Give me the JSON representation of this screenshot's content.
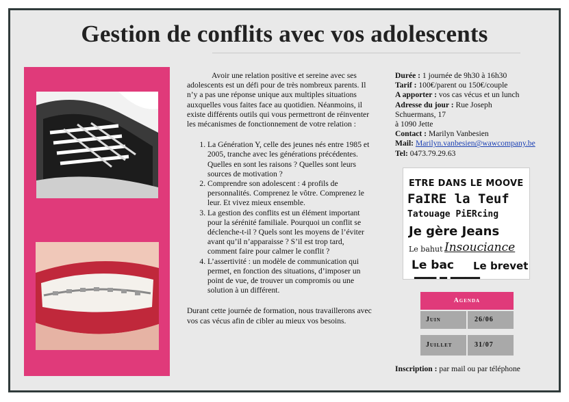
{
  "title": "Gestion de conflits avec vos adolescents",
  "intro": "Avoir une relation positive et sereine avec ses adolescents est un défi pour de très nombreux parents. Il n’y a pas une réponse unique aux multiples situations auxquelles vous faites face au quotidien. Néanmoins, il existe différents outils qui vous permettront de réinventer les mécanismes de fonctionnement de votre relation :",
  "points": [
    "La Génération Y, celle des jeunes nés entre 1985 et 2005, tranche avec les générations précédentes. Quelles en sont les raisons ? Quelles sont  leurs sources de motivation ?",
    "Comprendre son adolescent : 4 profils de personnalités. Comprenez le vôtre. Comprenez le leur.  Et vivez mieux ensemble.",
    "La gestion des conflits est un élément important pour la sérénité familiale. Pourquoi un conflit se déclenche-t-il ? Quels sont les moyens de l’éviter avant qu’il n’apparaisse ? S’il est trop tard, comment faire pour calmer le conflit ?",
    "L’assertivité : un modèle de communication qui permet, en fonction des situations, d’imposer un point de vue, de trouver un compromis ou une solution à un différent."
  ],
  "closing": "Durant cette journée de formation, nous travaillerons avec vos cas vécus afin de cibler au mieux vos besoins.",
  "info": {
    "duree_label": "Durée :",
    "duree_value": " 1 journée de 9h30 à 16h30",
    "tarif_label": "Tarif :",
    "tarif_value": " 100€/parent ou 150€/couple",
    "apporter_label": "A apporter :",
    "apporter_value": " vos cas vécus et un lunch",
    "adresse_label": "Adresse du jour :",
    "adresse_value1": " Rue Joseph",
    "adresse_value2": "Schuermans, 17",
    "adresse_value3": "à 1090 Jette",
    "contact_label": "Contact :",
    "contact_value": " Marilyn Vanbesien",
    "mail_label": "Mail:",
    "mail_value": "Marilyn.vanbesien@wawcompany.be",
    "tel_label": "Tel:",
    "tel_value": " 0473.79.29.63"
  },
  "collage": [
    "ETRE DANS LE MOOVE",
    "FaIRE la Teuf",
    "Tatouage PiERcing",
    "Je gère Jeans",
    "Le bahut",
    "Insouciance",
    "Le bac",
    "Le brevet"
  ],
  "agenda": {
    "header": "Agenda",
    "rows": [
      {
        "month": "Juin",
        "date": "26/06"
      },
      {
        "month": "Juillet",
        "date": "31/07"
      }
    ]
  },
  "inscription_label": "Inscription :",
  "inscription_value": " par mail ou par téléphone",
  "colors": {
    "accent": "#e03a7a",
    "frame": "#2f3a3a",
    "background": "#e9e9e9",
    "cell": "#a9a9a9"
  }
}
